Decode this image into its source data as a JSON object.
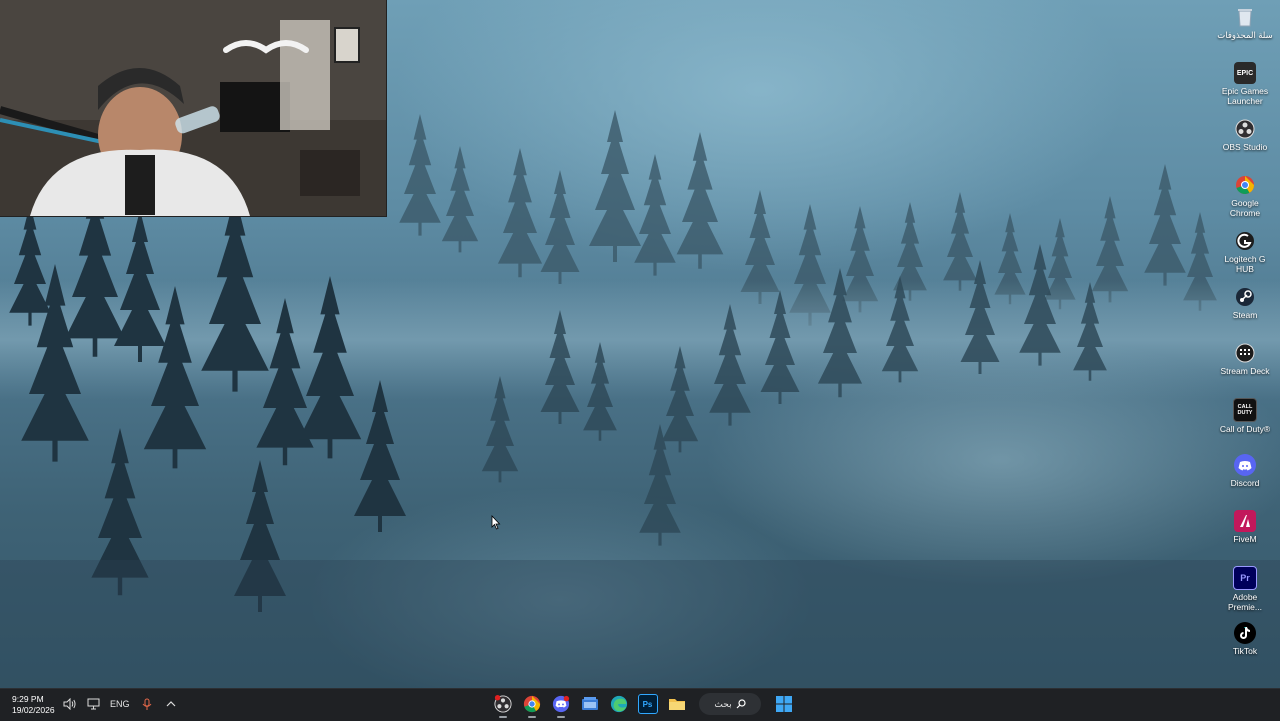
{
  "desktop": {
    "icons": [
      {
        "label": "سلة المحذوفات",
        "icon": "recycle-bin-icon"
      },
      {
        "label": "Epic Games Launcher",
        "icon": "epic-games-icon",
        "badge": "EPIC"
      },
      {
        "label": "OBS Studio",
        "icon": "obs-icon"
      },
      {
        "label": "Google Chrome",
        "icon": "chrome-icon"
      },
      {
        "label": "Logitech G HUB",
        "icon": "logitech-icon"
      },
      {
        "label": "Steam",
        "icon": "steam-icon"
      },
      {
        "label": "Stream Deck",
        "icon": "stream-deck-icon"
      },
      {
        "label": "Call of Duty®",
        "icon": "call-of-duty-icon",
        "badge": "CALL DUTY"
      },
      {
        "label": "Discord",
        "icon": "discord-icon"
      },
      {
        "label": "FiveM",
        "icon": "fivem-icon"
      },
      {
        "label": "Adobe Premie...",
        "icon": "premiere-icon",
        "badge": "Pr"
      },
      {
        "label": "TikTok",
        "icon": "tiktok-icon"
      }
    ]
  },
  "taskbar": {
    "time": "9:29 PM",
    "date": "19/02/2026",
    "language": "ENG",
    "search_label": "بحث",
    "apps": [
      {
        "name": "obs",
        "icon": "obs-icon"
      },
      {
        "name": "chrome",
        "icon": "chrome-icon"
      },
      {
        "name": "discord",
        "icon": "discord-icon"
      },
      {
        "name": "task-view",
        "icon": "task-view-icon"
      },
      {
        "name": "edge",
        "icon": "edge-icon"
      },
      {
        "name": "photoshop",
        "icon": "photoshop-icon",
        "badge": "Ps"
      },
      {
        "name": "file-explorer",
        "icon": "folder-icon"
      }
    ]
  },
  "colors": {
    "taskbar": "#1f2124",
    "accent": "#0a84ff"
  }
}
